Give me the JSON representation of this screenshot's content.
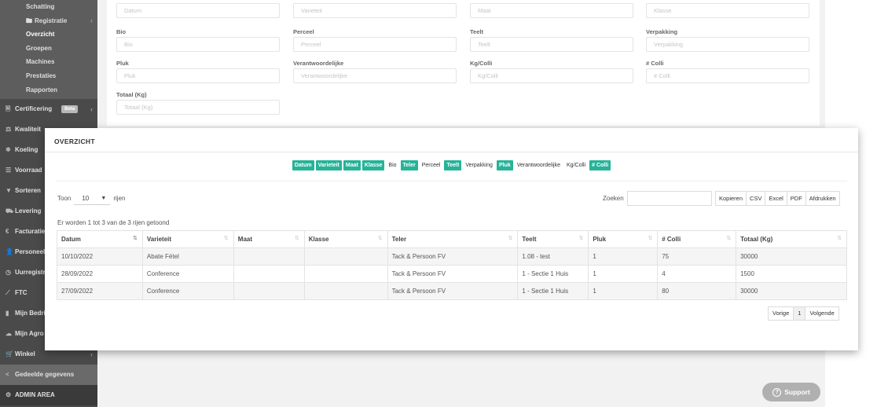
{
  "sidebar": {
    "sub_items": [
      {
        "label": "Schatting",
        "icon": "",
        "chevron": ""
      },
      {
        "label": "Registratie",
        "icon": "🖿",
        "chevron": "‹"
      },
      {
        "label": "Overzicht",
        "icon": "",
        "chevron": ""
      },
      {
        "label": "Groepen",
        "icon": "",
        "chevron": ""
      },
      {
        "label": "Machines",
        "icon": "",
        "chevron": ""
      },
      {
        "label": "Prestaties",
        "icon": "",
        "chevron": ""
      },
      {
        "label": "Rapporten",
        "icon": "",
        "chevron": ""
      }
    ],
    "items": [
      {
        "label": "Certificering",
        "icon": "🖹",
        "badge": "Beta",
        "chevron": "‹"
      },
      {
        "label": "Kwaliteit",
        "icon": "⚖",
        "badge": "",
        "chevron": ""
      },
      {
        "label": "Koeling",
        "icon": "❄",
        "badge": "",
        "chevron": ""
      },
      {
        "label": "Voorraad",
        "icon": "☰",
        "badge": "",
        "chevron": ""
      },
      {
        "label": "Sorteren",
        "icon": "▼",
        "badge": "",
        "chevron": ""
      },
      {
        "label": "Levering",
        "icon": "⛟",
        "badge": "",
        "chevron": ""
      },
      {
        "label": "Facturatie",
        "icon": "€",
        "badge": "",
        "chevron": ""
      },
      {
        "label": "Personeel",
        "icon": "👤",
        "badge": "",
        "chevron": ""
      },
      {
        "label": "Uurregistratie",
        "icon": "◷",
        "badge": "",
        "chevron": ""
      },
      {
        "label": "FTC",
        "icon": "⟋",
        "badge": "",
        "chevron": ""
      },
      {
        "label": "Mijn Bedrijf",
        "icon": "▮",
        "badge": "",
        "chevron": ""
      },
      {
        "label": "Mijn Agro",
        "icon": "☁",
        "badge": "",
        "chevron": ""
      },
      {
        "label": "Winkel",
        "icon": "🛒",
        "badge": "",
        "chevron": "‹"
      },
      {
        "label": "Gedeelde gegevens",
        "icon": "<",
        "badge": "",
        "chevron": ""
      },
      {
        "label": "ADMIN AREA",
        "icon": "⚙",
        "badge": "",
        "chevron": ""
      }
    ]
  },
  "form": {
    "fields": [
      {
        "label": "Datum",
        "placeholder": "Datum"
      },
      {
        "label": "Varieteit",
        "placeholder": "Varieteit"
      },
      {
        "label": "Maat",
        "placeholder": "Maat"
      },
      {
        "label": "Klasse",
        "placeholder": "Klasse"
      },
      {
        "label": "Bio",
        "placeholder": "Bio"
      },
      {
        "label": "Perceel",
        "placeholder": "Perceel"
      },
      {
        "label": "Teelt",
        "placeholder": "Teelt"
      },
      {
        "label": "Verpakking",
        "placeholder": "Verpakking"
      },
      {
        "label": "Pluk",
        "placeholder": "Pluk"
      },
      {
        "label": "Verantwoordelijke",
        "placeholder": "Verantwoordelijke"
      },
      {
        "label": "Kg/Colli",
        "placeholder": "Kg/Colli"
      },
      {
        "label": "# Colli",
        "placeholder": "# Colli"
      },
      {
        "label": "Totaal (Kg)",
        "placeholder": "Totaal (Kg)"
      }
    ]
  },
  "modal": {
    "title": "OVERZICHT",
    "column_toggles": [
      {
        "label": "Datum",
        "active": true
      },
      {
        "label": "Varieteit",
        "active": true
      },
      {
        "label": "Maat",
        "active": true
      },
      {
        "label": "Klasse",
        "active": true
      },
      {
        "label": "Bio",
        "active": false
      },
      {
        "label": "Teler",
        "active": true
      },
      {
        "label": "Perceel",
        "active": false
      },
      {
        "label": "Teelt",
        "active": true
      },
      {
        "label": "Verpakking",
        "active": false
      },
      {
        "label": "Pluk",
        "active": true
      },
      {
        "label": "Verantwoordelijke",
        "active": false
      },
      {
        "label": "Kg/Colli",
        "active": false
      },
      {
        "label": "# Colli",
        "active": true
      }
    ],
    "length": {
      "prefix": "Toon",
      "value": "10",
      "suffix": "rijen"
    },
    "search_label": "Zoeken",
    "export_buttons": [
      "Kopieren",
      "CSV",
      "Excel",
      "PDF",
      "Afdrukken"
    ],
    "info": "Er worden 1 tot 3 van de 3 rijen getoond",
    "columns": [
      "Datum",
      "Varieteit",
      "Maat",
      "Klasse",
      "Teler",
      "Teelt",
      "Pluk",
      "# Colli",
      "Totaal (Kg)"
    ],
    "rows": [
      [
        "10/10/2022",
        "Abate Fétel",
        "",
        "",
        "Tack & Persoon FV",
        "1.08 - test",
        "1",
        "75",
        "30000"
      ],
      [
        "28/09/2022",
        "Conference",
        "",
        "",
        "Tack & Persoon FV",
        "1 - Sectie 1 Huis",
        "1",
        "4",
        "1500"
      ],
      [
        "27/09/2022",
        "Conference",
        "",
        "",
        "Tack & Persoon FV",
        "1 - Sectie 1 Huis",
        "1",
        "80",
        "30000"
      ]
    ],
    "pagination": {
      "prev": "Vorige",
      "current": "1",
      "next": "Volgende"
    }
  },
  "support": {
    "label": "Support",
    "icon": "?"
  },
  "colors": {
    "accent": "#26b398",
    "sidebar": "#4a4a4a",
    "submenu": "#5d5d5d"
  }
}
